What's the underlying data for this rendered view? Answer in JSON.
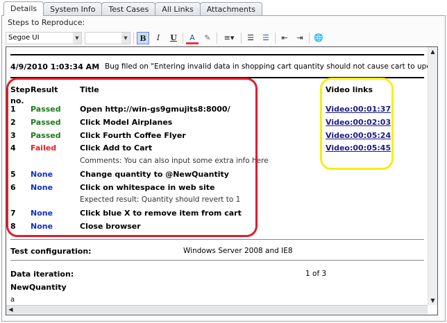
{
  "tabs": [
    "Details",
    "System Info",
    "Test Cases",
    "All Links",
    "Attachments"
  ],
  "steps_label": "Steps to Reproduce:",
  "toolbar": {
    "font": "Segoe UI",
    "size": "",
    "bold": "B",
    "italic": "I",
    "underline": "U",
    "font_color": "A"
  },
  "bug": {
    "timestamp": "4/9/2010 1:03:34 AM",
    "message": "Bug filed on \"Entering invalid data in shopping cart quantity should not cause cart to update.\""
  },
  "table": {
    "headers": {
      "step": "Step",
      "step2": "no.",
      "result": "Result",
      "title": "Title",
      "video": "Video links"
    },
    "rows": [
      {
        "step": "1",
        "result": "Passed",
        "title": "Open http://win-gs9gmujits8:8000/",
        "video": "Video:00:01:37"
      },
      {
        "step": "2",
        "result": "Passed",
        "title": "Click Model Airplanes",
        "video": "Video:00:02:03"
      },
      {
        "step": "3",
        "result": "Passed",
        "title": "Click Fourth Coffee Flyer",
        "video": "Video:00:05:24"
      },
      {
        "step": "4",
        "result": "Failed",
        "title": "Click Add to Cart",
        "video": "Video:00:05:45"
      },
      {
        "note": "Comments: You can also input some extra info here"
      },
      {
        "step": "5",
        "result": "None",
        "title": "Change quantity to @NewQuantity"
      },
      {
        "step": "6",
        "result": "None",
        "title": "Click on whitespace in web site"
      },
      {
        "note": "Expected result: Quantity should revert to 1"
      },
      {
        "step": "7",
        "result": "None",
        "title": "Click blue X to remove item from cart"
      },
      {
        "step": "8",
        "result": "None",
        "title": "Close browser"
      }
    ]
  },
  "config": {
    "label": "Test configuration:",
    "value": "Windows Server 2008 and IE8"
  },
  "iteration": {
    "label": "Data iteration:",
    "value": "1 of 3",
    "param": "NewQuantity",
    "param_value": "a"
  }
}
